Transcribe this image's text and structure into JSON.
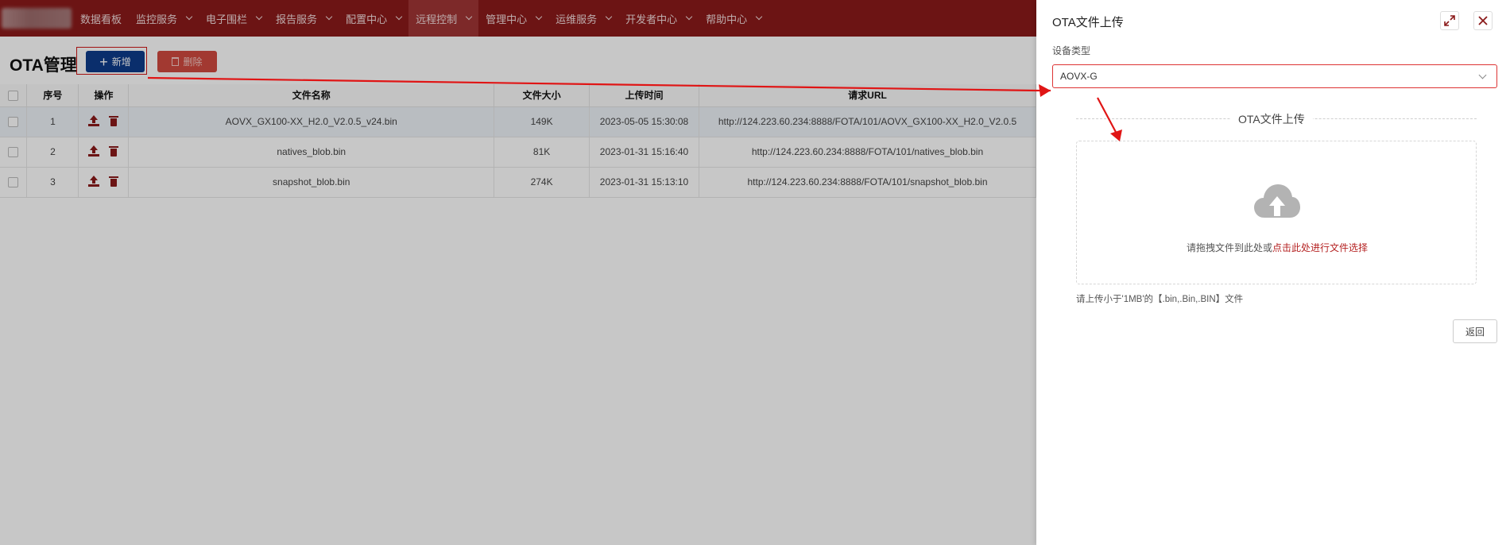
{
  "nav": {
    "items": [
      {
        "label": "数据看板",
        "chevron": false
      },
      {
        "label": "监控服务",
        "chevron": true
      },
      {
        "label": "电子围栏",
        "chevron": true
      },
      {
        "label": "报告服务",
        "chevron": true
      },
      {
        "label": "配置中心",
        "chevron": true
      },
      {
        "label": "远程控制",
        "chevron": true,
        "active": true
      },
      {
        "label": "管理中心",
        "chevron": true
      },
      {
        "label": "运维服务",
        "chevron": true
      },
      {
        "label": "开发者中心",
        "chevron": true
      },
      {
        "label": "帮助中心",
        "chevron": true
      }
    ]
  },
  "page": {
    "title": "OTA管理",
    "add_label": "新增",
    "delete_label": "删除"
  },
  "table": {
    "headers": {
      "index": "序号",
      "actions": "操作",
      "filename": "文件名称",
      "size": "文件大小",
      "time": "上传时间",
      "url": "请求URL"
    },
    "rows": [
      {
        "index": "1",
        "filename": "AOVX_GX100-XX_H2.0_V2.0.5_v24.bin",
        "size": "149K",
        "time": "2023-05-05 15:30:08",
        "url": "http://124.223.60.234:8888/FOTA/101/AOVX_GX100-XX_H2.0_V2.0.5"
      },
      {
        "index": "2",
        "filename": "natives_blob.bin",
        "size": "81K",
        "time": "2023-01-31 15:16:40",
        "url": "http://124.223.60.234:8888/FOTA/101/natives_blob.bin"
      },
      {
        "index": "3",
        "filename": "snapshot_blob.bin",
        "size": "274K",
        "time": "2023-01-31 15:13:10",
        "url": "http://124.223.60.234:8888/FOTA/101/snapshot_blob.bin"
      }
    ]
  },
  "drawer": {
    "title": "OTA文件上传",
    "device_type_label": "设备类型",
    "device_type_value": "AOVX-G",
    "section_title": "OTA文件上传",
    "dropzone_text": "请拖拽文件到此处或",
    "dropzone_link": "点击此处进行文件选择",
    "hint": "请上传小于'1MB'的【.bin,.Bin,.BIN】文件",
    "back_label": "返回"
  },
  "colors": {
    "nav_bg": "#8b1a1a",
    "primary": "#0d3c8b",
    "danger": "#d04a3f",
    "annotation": "#d01717"
  }
}
